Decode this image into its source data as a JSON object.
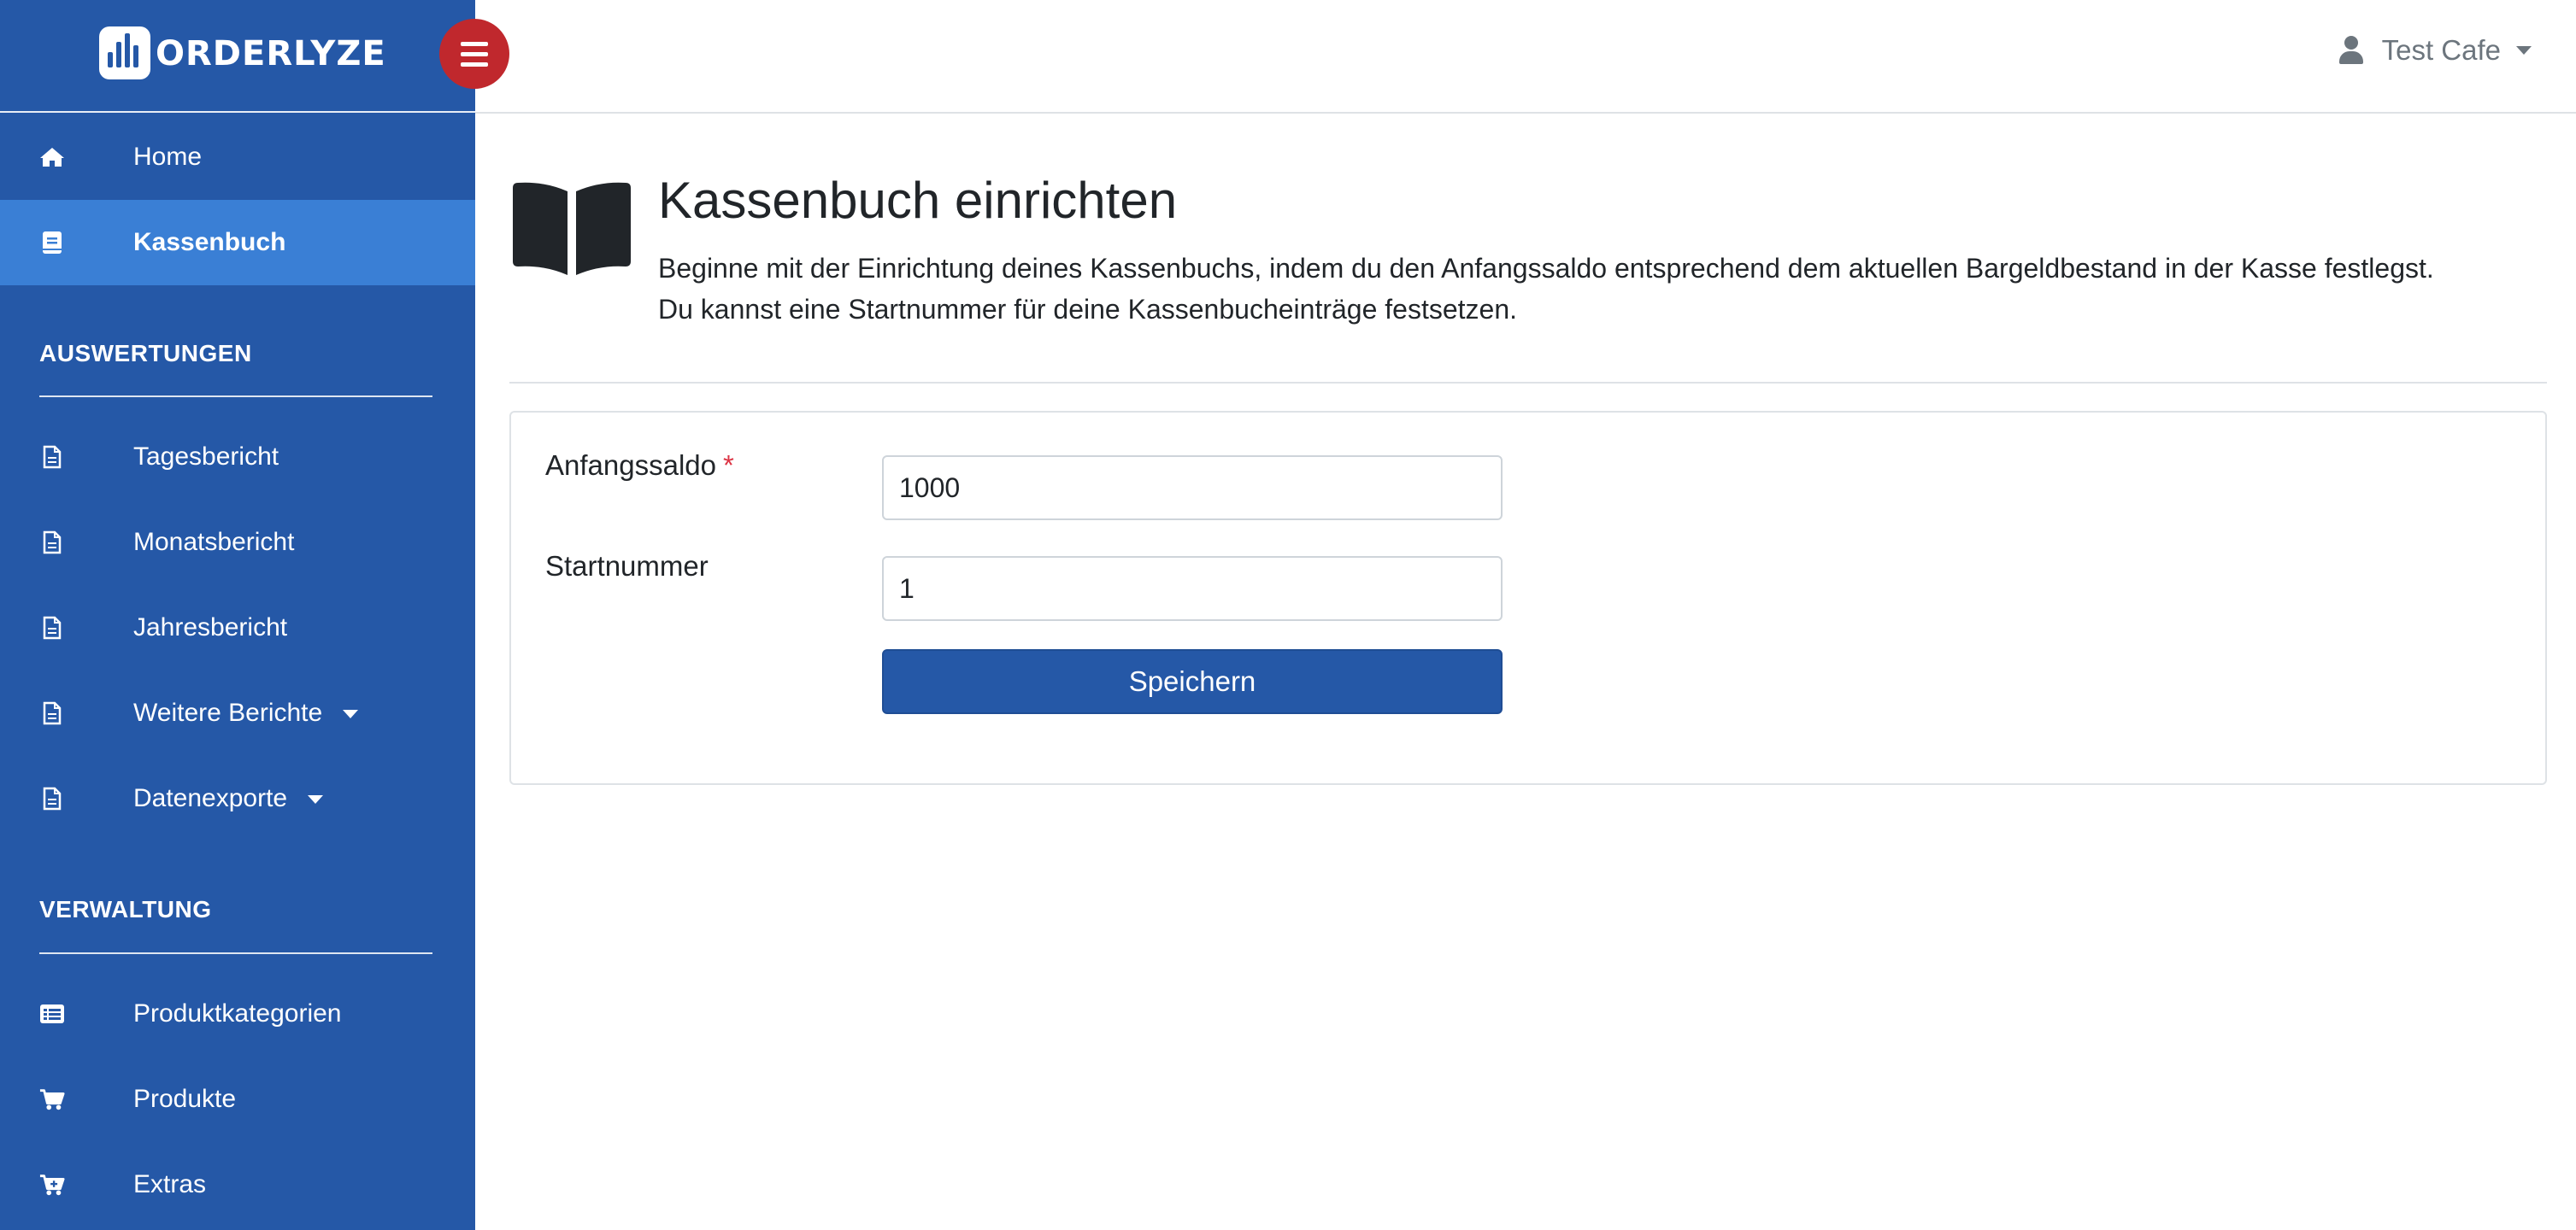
{
  "brand": {
    "name": "ORDERLYZE"
  },
  "colors": {
    "sidebar": "#2558a7",
    "active": "#3a7fd5",
    "hamburger": "#c0282d",
    "required": "#dc3545"
  },
  "header": {
    "user_name": "Test Cafe",
    "user_icon": "user-icon",
    "menu_icon": "hamburger-icon"
  },
  "sidebar": {
    "items_top": [
      {
        "label": "Home",
        "icon": "home-icon"
      },
      {
        "label": "Kassenbuch",
        "icon": "book-icon",
        "active": true
      }
    ],
    "section1": {
      "title": "AUSWERTUNGEN",
      "items": [
        {
          "label": "Tagesbericht",
          "icon": "document-icon"
        },
        {
          "label": "Monatsbericht",
          "icon": "document-icon"
        },
        {
          "label": "Jahresbericht",
          "icon": "document-icon"
        },
        {
          "label": "Weitere Berichte",
          "icon": "document-icon",
          "dropdown": true
        },
        {
          "label": "Datenexporte",
          "icon": "document-icon",
          "dropdown": true
        }
      ]
    },
    "section2": {
      "title": "VERWALTUNG",
      "items": [
        {
          "label": "Produktkategorien",
          "icon": "list-icon"
        },
        {
          "label": "Produkte",
          "icon": "cart-icon"
        },
        {
          "label": "Extras",
          "icon": "cart-plus-icon"
        }
      ]
    }
  },
  "main": {
    "title": "Kassenbuch einrichten",
    "description_line1": "Beginne mit der Einrichtung deines Kassenbuchs, indem du den Anfangssaldo entsprechend dem aktuellen Bargeldbestand in der Kasse festlegst.",
    "description_line2": "Du kannst eine Startnummer für deine Kassenbucheinträge festsetzen.",
    "form": {
      "opening_balance_label": "Anfangssaldo",
      "required_marker": "*",
      "opening_balance_value": "1000",
      "start_number_label": "Startnummer",
      "start_number_value": "1",
      "save_label": "Speichern"
    }
  }
}
